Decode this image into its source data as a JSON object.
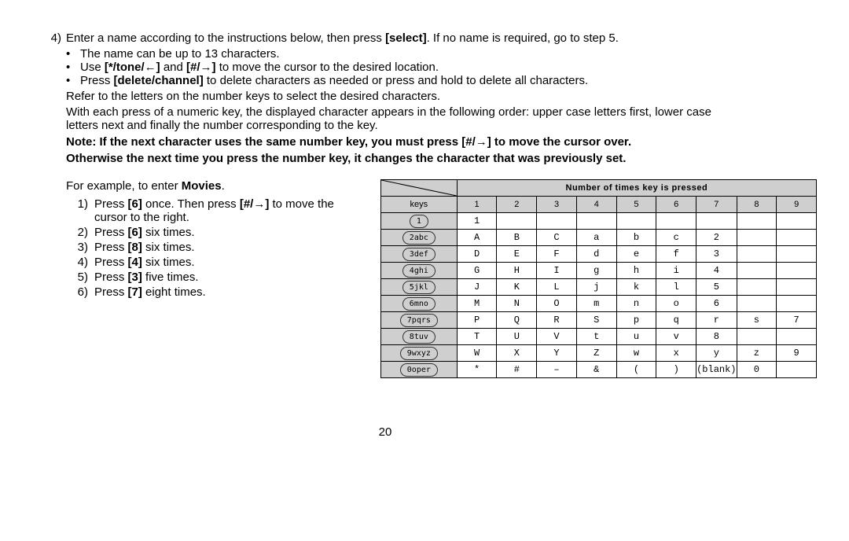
{
  "step4": {
    "number": "4)",
    "intro_pre": "Enter a name according to the instructions below, then press ",
    "intro_bold": "[select]",
    "intro_post": ". If no name is required, go to step 5.",
    "bullet1": "The name can be up to 13 characters.",
    "bullet2_pre": "Use ",
    "bullet2_b1": "[*/tone/←]",
    "bullet2_mid": " and ",
    "bullet2_b2": "[#/→]",
    "bullet2_post": " to move the cursor to the desired location.",
    "bullet3_pre": "Press ",
    "bullet3_b": "[delete/channel]",
    "bullet3_post": " to delete characters as needed or press and hold to delete all characters.",
    "plain1": "Refer to the letters on the number keys to select the desired characters.",
    "plain2": "With each press of a numeric key, the displayed character appears in the following order: upper case letters first, lower case letters next and finally the number corresponding to the key.",
    "note1": "Note: If the next character uses the same number key, you must press [#/→] to move the cursor over.",
    "note2": "Otherwise the next time you press the number key, it changes the character that was previously set."
  },
  "example": {
    "intro_pre": "For example, to enter ",
    "intro_bold": "Movies",
    "intro_post": ".",
    "items": [
      {
        "n": "1)",
        "pre": "Press ",
        "b1": "[6]",
        "mid": " once. Then press ",
        "b2": "[#/→]",
        "post": " to move the cursor to the right."
      },
      {
        "n": "2)",
        "pre": "Press ",
        "b1": "[6]",
        "mid": " six times.",
        "b2": "",
        "post": ""
      },
      {
        "n": "3)",
        "pre": "Press ",
        "b1": "[8]",
        "mid": " six times.",
        "b2": "",
        "post": ""
      },
      {
        "n": "4)",
        "pre": "Press ",
        "b1": "[4]",
        "mid": " six times.",
        "b2": "",
        "post": ""
      },
      {
        "n": "5)",
        "pre": "Press ",
        "b1": "[3]",
        "mid": " five times.",
        "b2": "",
        "post": ""
      },
      {
        "n": "6)",
        "pre": "Press ",
        "b1": "[7]",
        "mid": " eight times.",
        "b2": "",
        "post": ""
      }
    ]
  },
  "table": {
    "header_span": "Number of times key is pressed",
    "keys_label": "keys",
    "cols": [
      "1",
      "2",
      "3",
      "4",
      "5",
      "6",
      "7",
      "8",
      "9"
    ],
    "rows": [
      {
        "key": "1",
        "cells": [
          "1",
          "",
          "",
          "",
          "",
          "",
          "",
          "",
          ""
        ]
      },
      {
        "key": "2abc",
        "cells": [
          "A",
          "B",
          "C",
          "a",
          "b",
          "c",
          "2",
          "",
          ""
        ]
      },
      {
        "key": "3def",
        "cells": [
          "D",
          "E",
          "F",
          "d",
          "e",
          "f",
          "3",
          "",
          ""
        ]
      },
      {
        "key": "4ghi",
        "cells": [
          "G",
          "H",
          "I",
          "g",
          "h",
          "i",
          "4",
          "",
          ""
        ]
      },
      {
        "key": "5jkl",
        "cells": [
          "J",
          "K",
          "L",
          "j",
          "k",
          "l",
          "5",
          "",
          ""
        ]
      },
      {
        "key": "6mno",
        "cells": [
          "M",
          "N",
          "O",
          "m",
          "n",
          "o",
          "6",
          "",
          ""
        ]
      },
      {
        "key": "7pqrs",
        "cells": [
          "P",
          "Q",
          "R",
          "S",
          "p",
          "q",
          "r",
          "s",
          "7"
        ]
      },
      {
        "key": "8tuv",
        "cells": [
          "T",
          "U",
          "V",
          "t",
          "u",
          "v",
          "8",
          "",
          ""
        ]
      },
      {
        "key": "9wxyz",
        "cells": [
          "W",
          "X",
          "Y",
          "Z",
          "w",
          "x",
          "y",
          "z",
          "9"
        ]
      },
      {
        "key": "0oper",
        "cells": [
          "*",
          "#",
          "–",
          "&",
          "(",
          ")",
          "(blank)",
          "0",
          ""
        ]
      }
    ]
  },
  "page_number": "20"
}
